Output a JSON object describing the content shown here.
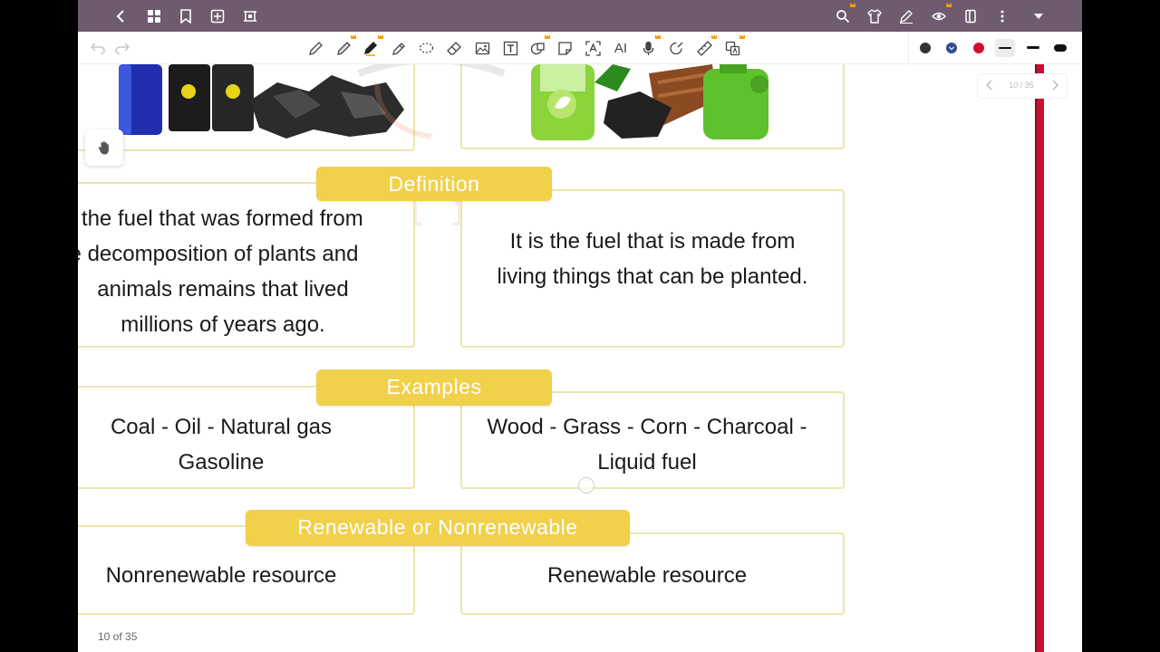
{
  "topbar": {
    "icons_left": [
      "back-icon",
      "grid-icon",
      "bookmark-icon",
      "add-page-icon",
      "crop-icon"
    ],
    "icons_right": [
      "search-icon",
      "shirt-icon",
      "pen-settings-icon",
      "eye-icon",
      "sidebar-icon",
      "more-icon",
      "dropdown-icon"
    ]
  },
  "toolbar": {
    "tools": [
      "pen-icon",
      "pencil-icon",
      "highlighter-icon",
      "marker-icon",
      "lasso-icon",
      "eraser-icon",
      "image-icon",
      "textbox-icon",
      "shape-icon",
      "sticker-icon",
      "ocr-icon",
      "ai-icon",
      "mic-icon",
      "laser-icon",
      "ruler-icon",
      "translate-icon"
    ],
    "ai_label": "AI",
    "swatch_colors": [
      "#333333",
      "#2f4e8f",
      "#d0102e"
    ],
    "active_tool_underline": "#f0c020"
  },
  "page_nav": {
    "counter": "10 / 35"
  },
  "watermark": {
    "text": "Dr. Mina Younan"
  },
  "sections": {
    "definition": {
      "header": "Definition",
      "left": [
        "s the fuel that was formed from",
        "e decomposition of plants and",
        "animals remains that lived",
        "millions of years ago."
      ],
      "right": [
        "It is the fuel that is made from",
        "living things that can be planted."
      ]
    },
    "examples": {
      "header": "Examples",
      "left": [
        "Coal - Oil - Natural gas",
        "Gasoline"
      ],
      "right": [
        "Wood - Grass - Corn - Charcoal -",
        "Liquid fuel"
      ]
    },
    "renewable": {
      "header": "Renewable or Nonrenewable",
      "left": [
        "Nonrenewable resource"
      ],
      "right": [
        "Renewable resource"
      ]
    }
  },
  "footer": {
    "page_label": "10 of 35"
  },
  "colors": {
    "header_yellow": "#f1d04a",
    "box_border": "#ece6ac",
    "topbar": "#6e5b6f",
    "accent_red": "#c8102e"
  }
}
